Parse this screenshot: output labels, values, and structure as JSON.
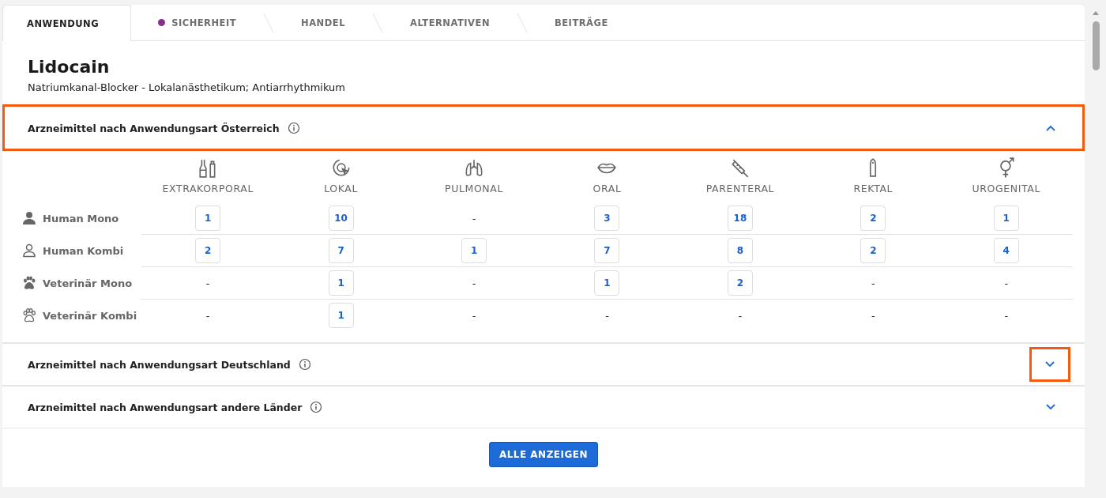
{
  "tabs": [
    {
      "label": "ANWENDUNG",
      "selected": true
    },
    {
      "label": "SICHERHEIT",
      "selected": false,
      "color": "#8b2d8e"
    },
    {
      "label": "HANDEL",
      "selected": false
    },
    {
      "label": "ALTERNATIVEN",
      "selected": false
    },
    {
      "label": "BEITRÄGE",
      "selected": false
    }
  ],
  "title": "Lidocain",
  "subtitle": "Natriumkanal-Blocker - Lokalanästhetikum; Antiarrhythmikum",
  "sections": [
    {
      "title": "Arzneimittel nach Anwendungsart Österreich",
      "expanded": true,
      "header_highlighted": true,
      "toggle_highlighted": false,
      "table": {
        "columns": [
          "EXTRAKORPORAL",
          "LOKAL",
          "PULMONAL",
          "ORAL",
          "PARENTERAL",
          "REKTAL",
          "UROGENITAL"
        ],
        "rows": [
          {
            "label": "Human Mono",
            "cells": [
              {
                "kind": "link",
                "value": "1"
              },
              {
                "kind": "link",
                "value": "10"
              },
              {
                "kind": "empty",
                "value": "-"
              },
              {
                "kind": "link",
                "value": "3"
              },
              {
                "kind": "link",
                "value": "18"
              },
              {
                "kind": "link",
                "value": "2"
              },
              {
                "kind": "link",
                "value": "1"
              }
            ]
          },
          {
            "label": "Human Kombi",
            "cells": [
              {
                "kind": "link",
                "value": "2"
              },
              {
                "kind": "link",
                "value": "7"
              },
              {
                "kind": "link",
                "value": "1"
              },
              {
                "kind": "link",
                "value": "7"
              },
              {
                "kind": "link",
                "value": "8"
              },
              {
                "kind": "link",
                "value": "2"
              },
              {
                "kind": "link",
                "value": "4"
              }
            ]
          },
          {
            "label": "Veterinär Mono",
            "cells": [
              {
                "kind": "empty",
                "value": "-"
              },
              {
                "kind": "link",
                "value": "1"
              },
              {
                "kind": "empty",
                "value": "-"
              },
              {
                "kind": "link",
                "value": "1"
              },
              {
                "kind": "link",
                "value": "2"
              },
              {
                "kind": "empty",
                "value": "-"
              },
              {
                "kind": "empty",
                "value": "-"
              }
            ]
          },
          {
            "label": "Veterinär Kombi",
            "cells": [
              {
                "kind": "empty",
                "value": "-"
              },
              {
                "kind": "link",
                "value": "1"
              },
              {
                "kind": "empty",
                "value": "-"
              },
              {
                "kind": "empty",
                "value": "-"
              },
              {
                "kind": "empty",
                "value": "-"
              },
              {
                "kind": "empty",
                "value": "-"
              },
              {
                "kind": "empty",
                "value": "-"
              }
            ]
          }
        ]
      }
    },
    {
      "title": "Arzneimittel nach Anwendungsart Deutschland",
      "expanded": false,
      "header_highlighted": false,
      "toggle_highlighted": true
    },
    {
      "title": "Arzneimittel nach Anwendungsart andere Länder",
      "expanded": false,
      "header_highlighted": false,
      "toggle_highlighted": false
    }
  ],
  "button": "ALLE ANZEIGEN"
}
